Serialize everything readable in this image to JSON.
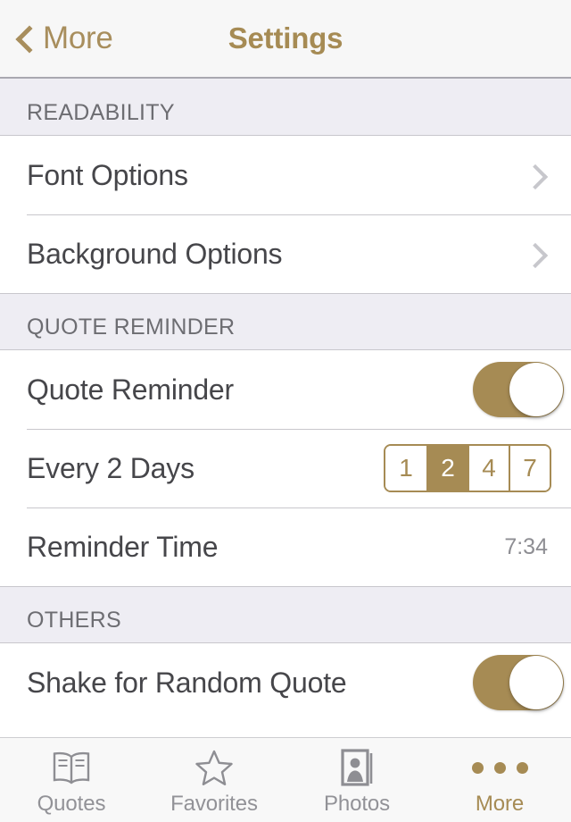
{
  "navbar": {
    "back_label": "More",
    "back_icon": "chevron-left-icon",
    "title": "Settings"
  },
  "colors": {
    "accent_gold": "#a68b54",
    "section_bg": "#eeedf3",
    "label_text": "#46464a",
    "secondary_text": "#8e8e93",
    "separator": "#c8c7cc"
  },
  "sections": [
    {
      "header": "READABILITY",
      "rows": [
        {
          "label": "Font Options",
          "accessory": "disclosure"
        },
        {
          "label": "Background Options",
          "accessory": "disclosure"
        }
      ]
    },
    {
      "header": "QUOTE REMINDER",
      "rows": [
        {
          "label": "Quote Reminder",
          "accessory": "switch",
          "switch_on": true
        },
        {
          "label": "Every 2 Days",
          "accessory": "segmented",
          "segments": [
            "1",
            "2",
            "4",
            "7"
          ],
          "selected_segment": "2"
        },
        {
          "label": "Reminder Time",
          "accessory": "value",
          "value": "7:34"
        }
      ]
    },
    {
      "header": "OTHERS",
      "rows": [
        {
          "label": "Shake for Random Quote",
          "accessory": "switch",
          "switch_on": true
        }
      ]
    }
  ],
  "tabbar": {
    "tabs": [
      {
        "label": "Quotes",
        "icon": "book-icon",
        "active": false
      },
      {
        "label": "Favorites",
        "icon": "star-icon",
        "active": false
      },
      {
        "label": "Photos",
        "icon": "photo-portrait-icon",
        "active": false
      },
      {
        "label": "More",
        "icon": "ellipsis-icon",
        "active": true
      }
    ]
  }
}
